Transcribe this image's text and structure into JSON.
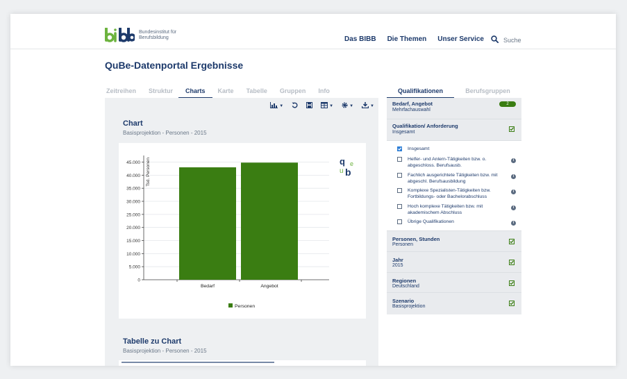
{
  "header": {
    "logo_text_line1": "Bundesinstitut für",
    "logo_text_line2": "Berufsbildung",
    "nav": [
      "Das BIBB",
      "Die Themen",
      "Unser Service"
    ],
    "search_label": "Suche"
  },
  "page_title": "QuBe-Datenportal Ergebnisse",
  "tabs": [
    "Zeitreihen",
    "Struktur",
    "Charts",
    "Karte",
    "Tabelle",
    "Gruppen",
    "Info"
  ],
  "active_tab": "Charts",
  "right_tabs": [
    "Qualifikationen",
    "Berufsgruppen"
  ],
  "chart_section": {
    "title": "Chart",
    "subtitle": "Basisprojektion - Personen - 2015"
  },
  "table_section": {
    "title": "Tabelle zu Chart",
    "subtitle": "Basisprojektion - Personen - 2015"
  },
  "chart_logo": {
    "letters": [
      "q",
      "u",
      "b",
      "e"
    ]
  },
  "chart_data": {
    "type": "bar",
    "categories": [
      "Bedarf",
      "Angebot"
    ],
    "series": [
      {
        "name": "Personen",
        "values": [
          43000,
          44800
        ],
        "color": "#3a7d12"
      }
    ],
    "title": "",
    "xlabel": "",
    "ylabel": "Tsd. Personen",
    "ylim": [
      0,
      47000
    ],
    "yticks": [
      0,
      5000,
      10000,
      15000,
      20000,
      25000,
      30000,
      35000,
      40000,
      45000
    ],
    "ytick_labels": [
      "0",
      "5.000",
      "10.000",
      "15.000",
      "20.000",
      "25.000",
      "30.000",
      "35.000",
      "40.000",
      "45.000"
    ],
    "grid": true,
    "legend": "bottom"
  },
  "facets": {
    "bedarf": {
      "title": "Bedarf, Angebot",
      "sub": "Mehrfachauswahl",
      "count": "2"
    },
    "quali": {
      "title": "Qualifikation/ Anforderung",
      "sub": "Insgesamt"
    },
    "options": [
      {
        "label": "Insgesamt",
        "checked": true
      },
      {
        "label": "Helfer- und Anlern-Tätigkeiten bzw. o. abgeschloss. Berufsausb.",
        "checked": false
      },
      {
        "label": "Fachlich ausgerichtete Tätigkeiten bzw. mit abgeschl. Berufsausbildung",
        "checked": false
      },
      {
        "label": "Komplexe Spezialisten-Tätigkeiten bzw. Fortbildungs- oder Bachelorabschluss",
        "checked": false
      },
      {
        "label": "Hoch komplexe Tätigkeiten bzw. mit akademischem Abschluss",
        "checked": false
      },
      {
        "label": "Übrige Qualifikationen",
        "checked": false
      }
    ],
    "personen": {
      "title": "Personen, Stunden",
      "sub": "Personen"
    },
    "jahr": {
      "title": "Jahr",
      "sub": "2015"
    },
    "regionen": {
      "title": "Regionen",
      "sub": "Deutschland"
    },
    "szenario": {
      "title": "Szenario",
      "sub": "Basisprojektion"
    }
  },
  "colors": {
    "brand_green": "#3a7d12",
    "navy": "#1d3a6b",
    "accent_blue": "#2f7fd6"
  }
}
